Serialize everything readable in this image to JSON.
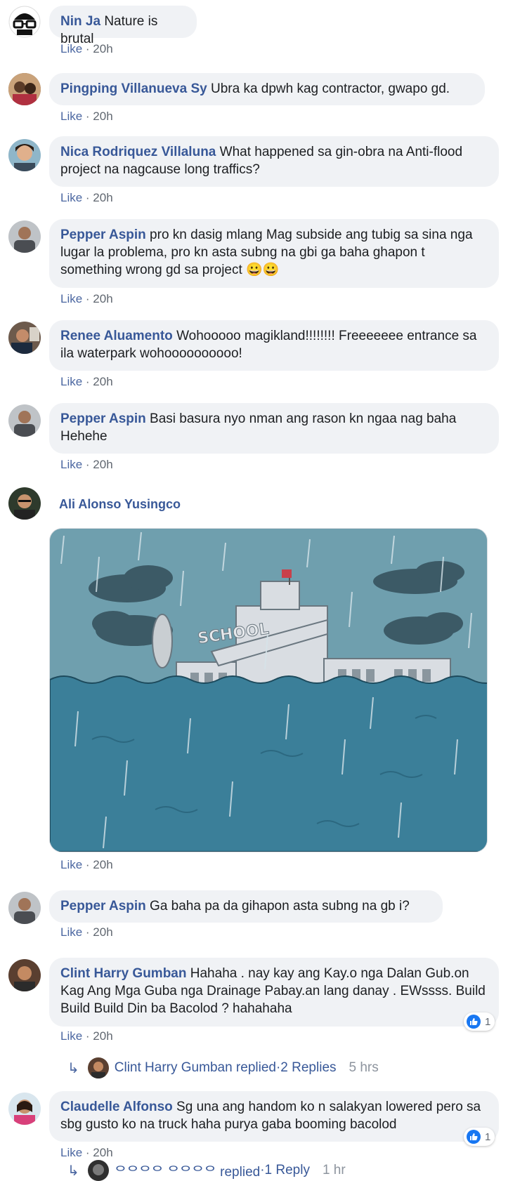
{
  "comments": [
    {
      "name": "Nin Ja",
      "text": "Nature is brutal",
      "like": "Like",
      "time": "20h"
    },
    {
      "name": "Pingping Villanueva Sy",
      "text": "Ubra ka dpwh kag contractor, gwapo gd.",
      "like": "Like",
      "time": "20h"
    },
    {
      "name": "Nica Rodriquez Villaluna",
      "text": "What happened sa gin-obra na Anti-flood project na nagcause long traffics?",
      "like": "Like",
      "time": "20h"
    },
    {
      "name": "Pepper Aspin",
      "text": "pro kn dasig mlang Mag subside ang tubig sa sina nga lugar la problema, pro kn asta subng na gbi ga baha ghapon t something wrong gd sa project 😀😀",
      "like": "Like",
      "time": "20h"
    },
    {
      "name": "Renee Aluamento",
      "text": "Wohooooo magikland!!!!!!!! Freeeeeee entrance sa ila waterpark wohoooooooooo!",
      "like": "Like",
      "time": "20h"
    },
    {
      "name": "Pepper Aspin",
      "text": "Basi basura nyo nman ang rason kn ngaa nag baha Hehehe",
      "like": "Like",
      "time": "20h"
    },
    {
      "name": "Ali Alonso Yusingco",
      "text": "",
      "like": "Like",
      "time": "20h",
      "image_text": "SCHOOL"
    },
    {
      "name": "Pepper Aspin",
      "text": "Ga baha pa da gihapon asta subng na gb i?",
      "like": "Like",
      "time": "20h"
    },
    {
      "name": "Clint Harry Gumban",
      "text": "Hahaha . nay kay ang Kay.o nga Dalan Gub.on Kag Ang Mga Guba nga Drainage Pabay.an lang danay . EWssss. Build Build Build Din ba Bacolod ? hahahaha",
      "like": "Like",
      "time": "20h",
      "reactions": "1",
      "reply": {
        "name": "Clint Harry Gumban replied",
        "count": "2 Replies",
        "time": "5 hrs"
      }
    },
    {
      "name": "Claudelle Alfonso",
      "text": "Sg una ang handom ko n salakyan lowered pero sa sbg gusto ko na truck haha purya gaba booming bacolod",
      "like": "Like",
      "time": "20h",
      "reactions": "1",
      "reply": {
        "name": "ᄋᄋᄋᄋ ᄋᄋᄋᄋ replied",
        "count": "1 Reply",
        "time": "1 hr"
      }
    }
  ],
  "sep": " · ",
  "colors": {
    "name": "#385898",
    "bubble": "#f0f2f5",
    "like_blue": "#1877f2"
  }
}
